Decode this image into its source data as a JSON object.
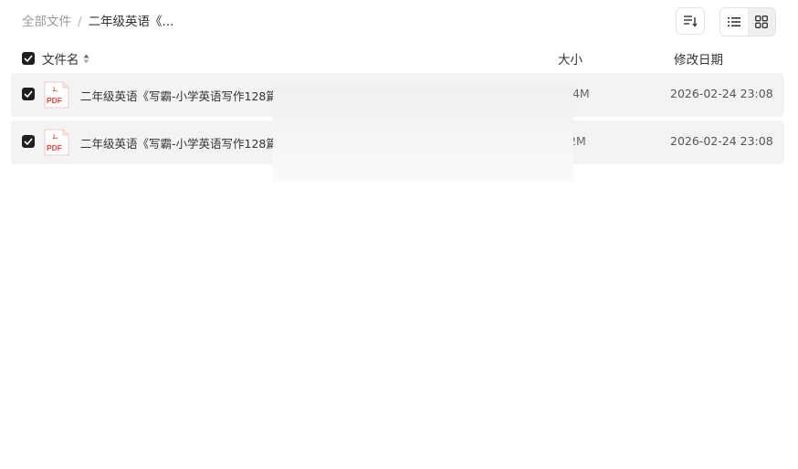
{
  "breadcrumb": {
    "root": "全部文件",
    "separator": "/",
    "current": "二年级英语《..."
  },
  "toolbar": {
    "sort_icon": "sort-icon",
    "list_view_icon": "list-view-icon",
    "grid_view_icon": "grid-view-icon",
    "active_view": "grid"
  },
  "table": {
    "header": {
      "name": "文件名",
      "size": "大小",
      "date": "修改日期",
      "select_all_checked": true
    },
    "rows": [
      {
        "name": "二年级英语《写霸-小学英语写作128篇》",
        "size": ".4M",
        "date": "2026-02-24 23:08",
        "type": "PDF",
        "checked": true
      },
      {
        "name": "二年级英语《写霸-小学英语写作128篇》",
        "size": "2M",
        "date": "2026-02-24 23:08",
        "type": "PDF",
        "checked": true
      }
    ]
  },
  "colors": {
    "row_bg": "#f3f3f3",
    "checkbox": "#1f1f1f",
    "pdf_red": "#e2463f"
  }
}
